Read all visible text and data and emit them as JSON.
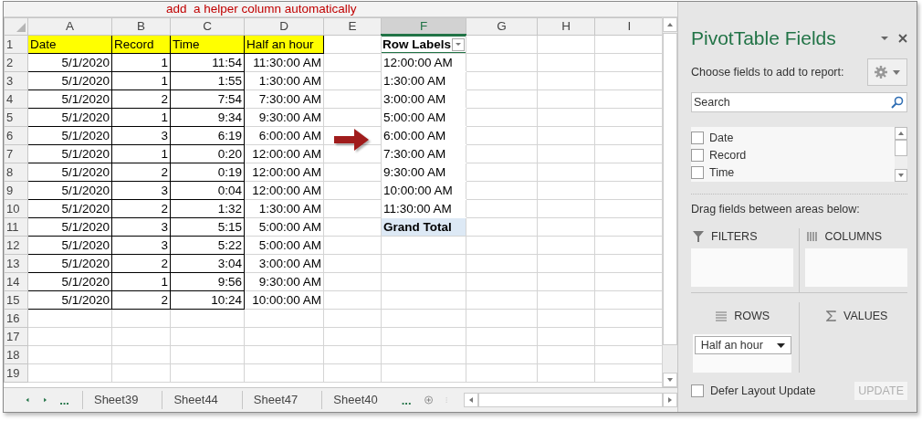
{
  "annotation": "add  a helper column automatically",
  "columns": [
    "A",
    "B",
    "C",
    "D",
    "E",
    "F",
    "G",
    "H",
    "I"
  ],
  "row_numbers": [
    "1",
    "2",
    "3",
    "4",
    "5",
    "6",
    "7",
    "8",
    "9",
    "10",
    "11",
    "12",
    "13",
    "14",
    "15",
    "16",
    "17",
    "18",
    "19"
  ],
  "source_table": {
    "headers": [
      "Date",
      "Record",
      "Time",
      "Half an hour"
    ],
    "rows": [
      [
        "5/1/2020",
        "1",
        "11:54",
        "11:30:00 AM"
      ],
      [
        "5/1/2020",
        "1",
        "1:55",
        "1:30:00 AM"
      ],
      [
        "5/1/2020",
        "2",
        "7:54",
        "7:30:00 AM"
      ],
      [
        "5/1/2020",
        "1",
        "9:34",
        "9:30:00 AM"
      ],
      [
        "5/1/2020",
        "3",
        "6:19",
        "6:00:00 AM"
      ],
      [
        "5/1/2020",
        "1",
        "0:20",
        "12:00:00 AM"
      ],
      [
        "5/1/2020",
        "2",
        "0:19",
        "12:00:00 AM"
      ],
      [
        "5/1/2020",
        "3",
        "0:04",
        "12:00:00 AM"
      ],
      [
        "5/1/2020",
        "2",
        "1:32",
        "1:30:00 AM"
      ],
      [
        "5/1/2020",
        "3",
        "5:15",
        "5:00:00 AM"
      ],
      [
        "5/1/2020",
        "3",
        "5:22",
        "5:00:00 AM"
      ],
      [
        "5/1/2020",
        "2",
        "3:04",
        "3:00:00 AM"
      ],
      [
        "5/1/2020",
        "1",
        "9:56",
        "9:30:00 AM"
      ],
      [
        "5/1/2020",
        "2",
        "10:24",
        "10:00:00 AM"
      ]
    ]
  },
  "pivot": {
    "header": "Row Labels",
    "items": [
      "12:00:00 AM",
      "1:30:00 AM",
      "3:00:00 AM",
      "5:00:00 AM",
      "6:00:00 AM",
      "7:30:00 AM",
      "9:30:00 AM",
      "10:00:00 AM",
      "11:30:00 AM"
    ],
    "total": "Grand Total"
  },
  "sheet_tabs": {
    "more_left": "...",
    "tabs": [
      "Sheet39",
      "Sheet44",
      "Sheet47",
      "Sheet40"
    ],
    "more_right": "..."
  },
  "panel": {
    "title": "PivotTable Fields",
    "subtitle": "Choose fields to add to report:",
    "search": {
      "placeholder": "Search"
    },
    "fields": [
      {
        "label": "Date",
        "checked": false
      },
      {
        "label": "Record",
        "checked": false
      },
      {
        "label": "Time",
        "checked": false
      }
    ],
    "drag_hint": "Drag fields between areas below:",
    "areas": [
      {
        "kind": "filters",
        "label": "FILTERS"
      },
      {
        "kind": "columns",
        "label": "COLUMNS"
      },
      {
        "kind": "rows",
        "label": "ROWS",
        "items": [
          "Half an hour"
        ]
      },
      {
        "kind": "values",
        "label": "VALUES"
      }
    ],
    "defer": {
      "label": "Defer Layout Update",
      "checked": false
    },
    "update_button": {
      "label": "UPDATE",
      "disabled": true
    }
  }
}
